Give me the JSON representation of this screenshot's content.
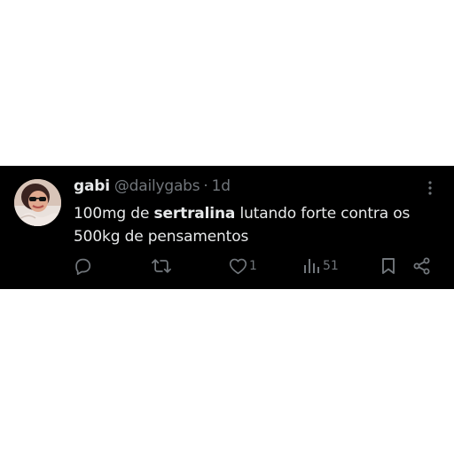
{
  "tweet": {
    "display_name": "gabi",
    "handle": "@dailygabs",
    "separator": "·",
    "time": "1d",
    "text_before": "100mg de ",
    "text_bold": "sertralina",
    "text_after": " lutando forte contra os 500kg de pensamentos"
  },
  "actions": {
    "reply_icon": "reply-icon",
    "retweet_icon": "retweet-icon",
    "like_icon": "heart-icon",
    "like_count": "1",
    "views_icon": "views-icon",
    "views_count": "51",
    "bookmark_icon": "bookmark-icon",
    "share_icon": "share-icon"
  },
  "colors": {
    "card_background": "#000000",
    "primary_text": "#e7e9ea",
    "secondary_text": "#71767b",
    "page_background": "#ffffff"
  }
}
